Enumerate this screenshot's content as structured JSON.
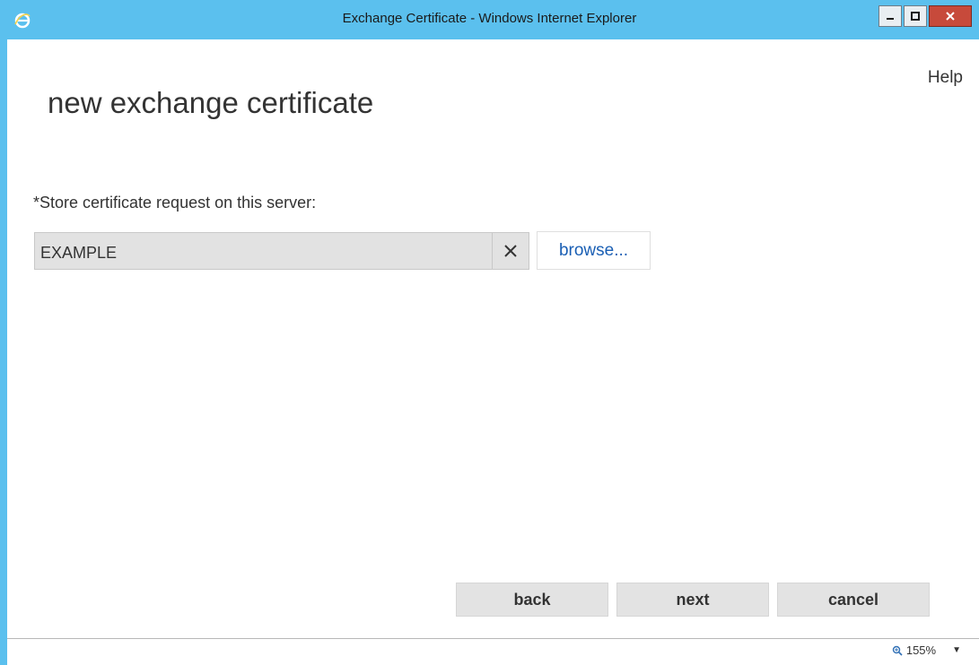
{
  "window": {
    "title": "Exchange Certificate - Windows Internet Explorer",
    "app_icon": "ie-icon",
    "controls": [
      "minimize",
      "maximize",
      "close"
    ]
  },
  "header": {
    "help_label": "Help",
    "page_title": "new exchange certificate"
  },
  "form": {
    "label": "*Store certificate request on this server:",
    "server_value": "EXAMPLE",
    "clear_icon": "close-x-icon",
    "browse_label": "browse..."
  },
  "footer": {
    "back_label": "back",
    "next_label": "next",
    "cancel_label": "cancel"
  },
  "status": {
    "zoom_label": "155%"
  },
  "colors": {
    "titlebar": "#5bc0ee",
    "link": "#1a5fb4",
    "close_button": "#c74a3b"
  }
}
